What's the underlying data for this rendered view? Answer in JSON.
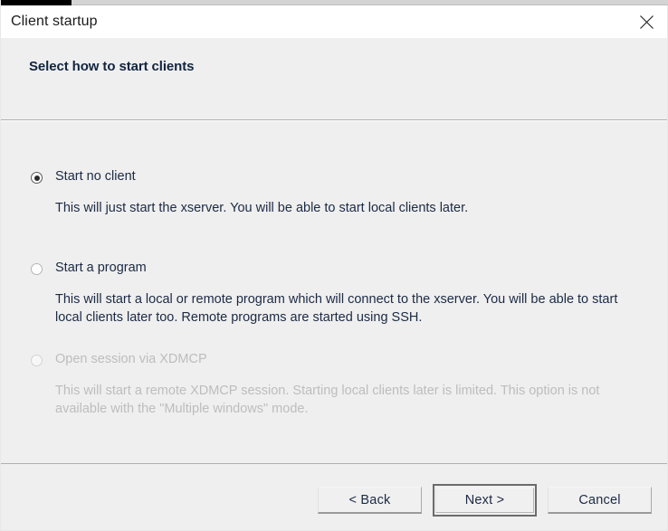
{
  "window": {
    "title": "Client startup",
    "close_icon": "close-icon"
  },
  "header": {
    "title": "Select how to start clients"
  },
  "options": [
    {
      "id": "start-no-client",
      "label": "Start no client",
      "description": "This will just start the xserver. You will be able to start local clients later.",
      "selected": true,
      "disabled": false
    },
    {
      "id": "start-a-program",
      "label": "Start a program",
      "description": "This will start a local or remote program which will connect to the xserver. You will be able to start local clients later too. Remote programs are started using SSH.",
      "selected": false,
      "disabled": false
    },
    {
      "id": "open-session-via-xdmcp",
      "label": "Open session via XDMCP",
      "description": "This will start a remote XDMCP session. Starting local clients later is limited. This option is not available with the \"Multiple windows\" mode.",
      "selected": false,
      "disabled": true
    }
  ],
  "footer": {
    "back_label": "< Back",
    "next_label": "Next >",
    "cancel_label": "Cancel"
  },
  "colors": {
    "window_background": "#efefef",
    "titlebar_background": "#ffffff",
    "text": "#1c2a44",
    "heading": "#12243f",
    "disabled_text": "#bdbdbd",
    "separator": "#b0b0b0"
  }
}
